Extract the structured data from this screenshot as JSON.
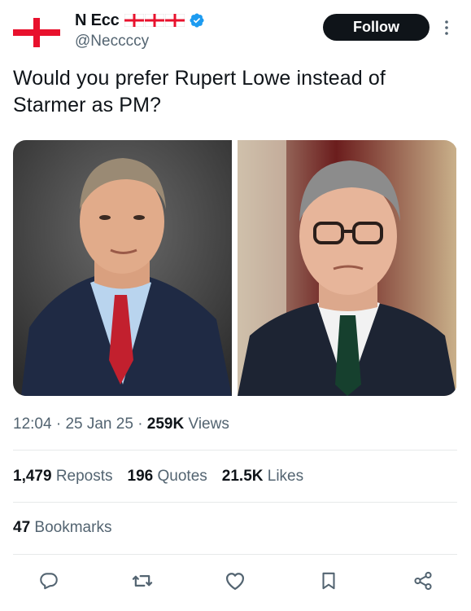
{
  "user": {
    "name": "N Ecc",
    "handle": "@Neccccy",
    "verified": true,
    "flag_count": 3
  },
  "follow_label": "Follow",
  "tweet_text": "Would you prefer Rupert Lowe instead of Starmer as PM?",
  "meta": {
    "time": "12:04",
    "date": "25 Jan 25",
    "views_count": "259K",
    "views_label": "Views"
  },
  "stats": {
    "reposts_count": "1,479",
    "reposts_label": "Reposts",
    "quotes_count": "196",
    "quotes_label": "Quotes",
    "likes_count": "21.5K",
    "likes_label": "Likes",
    "bookmarks_count": "47",
    "bookmarks_label": "Bookmarks"
  },
  "actions": [
    "reply-icon",
    "repost-icon",
    "like-icon",
    "bookmark-icon",
    "share-icon"
  ],
  "colors": {
    "text": "#0f1419",
    "secondary": "#536471",
    "verified": "#1d9bf0",
    "flag_red": "#e8112d",
    "divider": "#e7e9ea"
  }
}
